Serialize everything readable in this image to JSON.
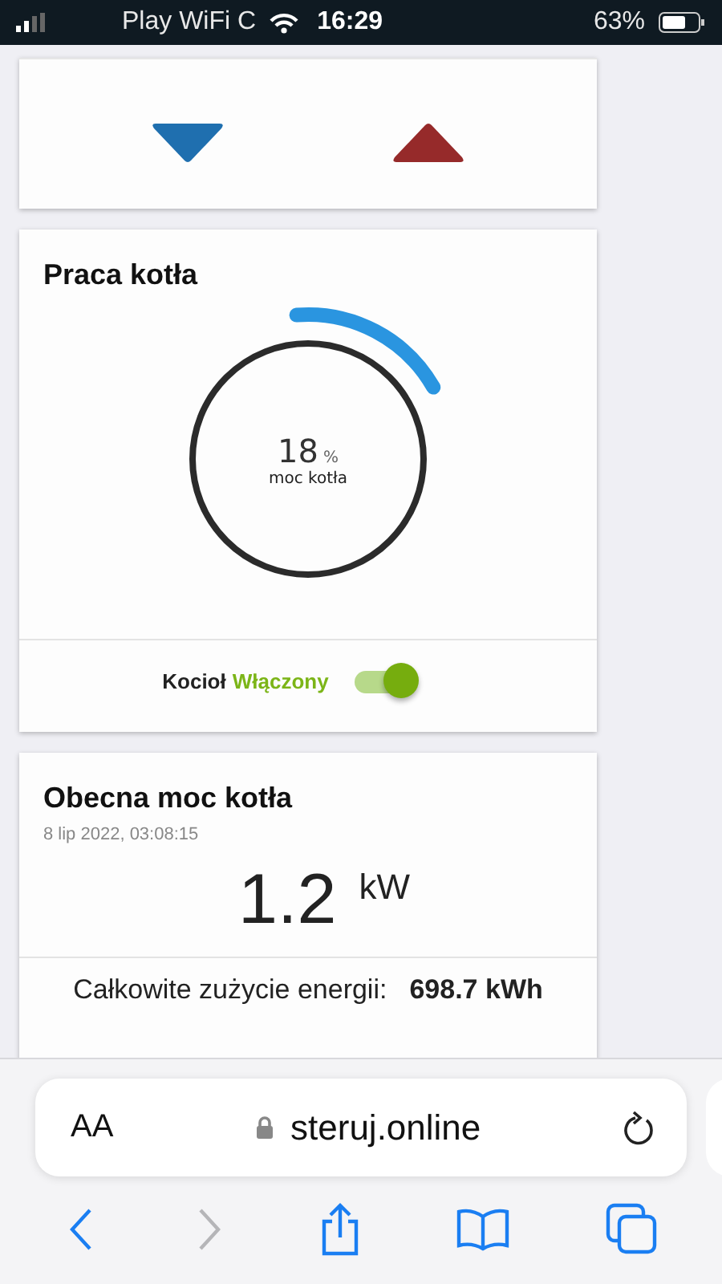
{
  "status_bar": {
    "carrier": "Play WiFi C",
    "time": "16:29",
    "battery": "63%"
  },
  "setpoint_card": {
    "buttons": [
      {
        "kind": "down"
      },
      {
        "kind": "up"
      }
    ]
  },
  "boiler_card": {
    "title": "Praca kotła",
    "gauge": {
      "value": "18",
      "unit": "%",
      "label": "moc kotła"
    },
    "switch": {
      "label": "Kocioł",
      "state_text": "Włączony",
      "on": true
    }
  },
  "power_card": {
    "title": "Obecna moc kotła",
    "timestamp": "8 lip 2022, 03:08:15",
    "value": "1.2",
    "unit": "kW",
    "total_label": "Całkowite zużycie energii:",
    "total_value": "698.7 kWh"
  },
  "browser": {
    "text_size": "AA",
    "url": "steruj.online",
    "toolbar": [
      {
        "kind": "back",
        "disabled": false
      },
      {
        "kind": "forward",
        "disabled": true
      },
      {
        "kind": "share",
        "disabled": false
      },
      {
        "kind": "bookmarks",
        "disabled": false
      },
      {
        "kind": "tabs",
        "disabled": false
      }
    ]
  }
}
